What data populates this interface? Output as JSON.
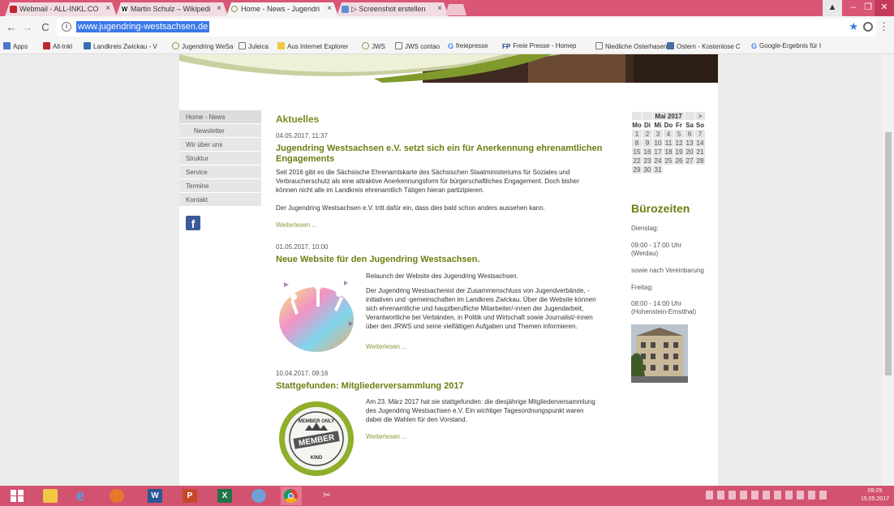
{
  "browser": {
    "tabs": [
      {
        "label": "Webmail - ALL-INKL.CO"
      },
      {
        "label": "Martin Schulz – Wikipedi"
      },
      {
        "label": "Home - News - Jugendri"
      },
      {
        "label": "▷ Screenshot erstellen"
      }
    ],
    "url": "www.jugendring-westsachsen.de",
    "bookmarks": [
      {
        "label": "Apps"
      },
      {
        "label": "All-Inkl"
      },
      {
        "label": "Landkreis Zwickau - V"
      },
      {
        "label": "Jugendring WeSa"
      },
      {
        "label": "Juleica"
      },
      {
        "label": "Aus Internet Explorer"
      },
      {
        "label": "JWS"
      },
      {
        "label": "JWS contao"
      },
      {
        "label": "freiepresse"
      },
      {
        "label": "Freie Presse - Homep"
      },
      {
        "label": "Niedliche Osterhasen"
      },
      {
        "label": "Ostern - Kostenlose C"
      },
      {
        "label": "Google-Ergebnis für I"
      }
    ]
  },
  "site": {
    "nav": [
      {
        "label": "Home - News"
      },
      {
        "label": "Newsletter"
      },
      {
        "label": "Wir über uns"
      },
      {
        "label": "Struktur"
      },
      {
        "label": "Service"
      },
      {
        "label": "Termine"
      },
      {
        "label": "Kontakt"
      }
    ],
    "section_title": "Aktuelles",
    "more_label": "Weiterlesen ...",
    "articles": [
      {
        "date": "04.05.2017, 11:37",
        "title_l1": "Jugendring Westsachsen e.V. setzt sich ein für Anerkennung ehrenamtlichen",
        "title_l2": "Engagements",
        "p1_l1": "Seit 2016 gibt es die Sächsische Ehrenamtskarte des Sächsischen Staatministeriums für Soziales und",
        "p1_l2": "Verbraucherschutz als eine attraktive Anerkennungsform für bürgerschaftliches Engagement. Doch bisher",
        "p1_l3": "können nicht alle im Landkreis ehrenamtlich Tätigen hieran partizipieren.",
        "p2": "Der Jugendring Westsachsen e.V. tritt dafür ein, dass dies bald schon anders aussehen kann."
      },
      {
        "date": "01.05.2017, 10:00",
        "title": "Neue Website für den Jugendring Westsachsen.",
        "p1": "Relaunch der Website des Jugendring Westsachsen.",
        "p2_l1": "Der Jugendring Westsachenist der Zusammenschluss von  Jugendverbände, -",
        "p2_l2": "initiativen und -gemeinschaften im Landkreis Zwickau. Über die Website können",
        "p2_l3": "sich ehrenamtliche und hauptberufliche Mitarbeiter/-innen der Jugendarbeit,",
        "p2_l4": "Verantwortliche bei Verbänden, in Politik und Wirtschaft sowie Journalist/-innen",
        "p2_l5": "über den JRWS und seine vielfältigen Aufgaben und Themen informieren."
      },
      {
        "date": "10.04.2017, 09:16",
        "title": "Stattgefunden: Mitgliederversammlung 2017",
        "p1_l1": "Am 23. März 2017 hat sie stattgefunden: die diesjährige Mitgliederversammlung",
        "p1_l2": "des Jugendring Westsachsen e.V. Ein wichtiger Tagesordnungspunkt waren",
        "p1_l3": "dabei die Wahlen für den Vorstand.",
        "badge_top": "MEMBER ONLY",
        "badge_mid": "MEMBER",
        "badge_bot": "KIND"
      }
    ],
    "calendar": {
      "title": "Mai 2017",
      "next": ">",
      "weekdays": [
        "Mo",
        "Di",
        "Mi",
        "Do",
        "Fr",
        "Sa",
        "So"
      ],
      "weeks": [
        [
          "1",
          "2",
          "3",
          "4",
          "5",
          "6",
          "7"
        ],
        [
          "8",
          "9",
          "10",
          "11",
          "12",
          "13",
          "14"
        ],
        [
          "15",
          "16",
          "17",
          "18",
          "19",
          "20",
          "21"
        ],
        [
          "22",
          "23",
          "24",
          "25",
          "26",
          "27",
          "28"
        ],
        [
          "29",
          "30",
          "31",
          "",
          "",
          "",
          ""
        ]
      ]
    },
    "office": {
      "title": "Bürozeiten",
      "day1": "Dienstag:",
      "hours1_l1": "09:00 - 17:00 Uhr",
      "hours1_l2": "(Werdau)",
      "note": "sowie nach Vereinbarung",
      "day2": "Freitag:",
      "hours2_l1": "08:00 - 14:00 Uhr",
      "hours2_l2": "(Hohenstein-Ernstthal)"
    }
  },
  "taskbar": {
    "time": "09:29",
    "date": "15.05.2017"
  },
  "colors": {
    "accent": "#d95676",
    "site_green": "#7a8c1e"
  }
}
